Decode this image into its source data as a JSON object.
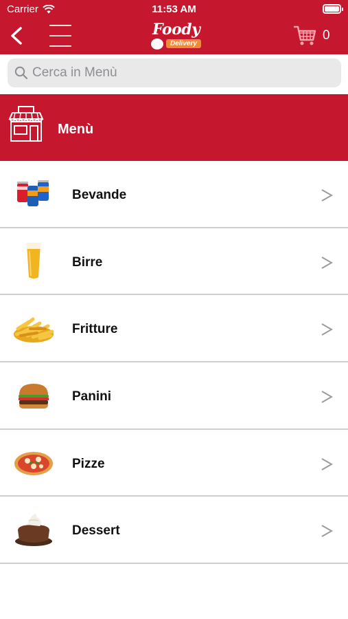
{
  "status_bar": {
    "carrier": "Carrier",
    "time": "11:53 AM",
    "battery_level": 1.0
  },
  "header": {
    "logo_word": "Foody",
    "logo_tag": "Delivery",
    "cart_count": "0"
  },
  "search": {
    "placeholder": "Cerca in Menù",
    "value": ""
  },
  "section": {
    "title": "Menù"
  },
  "categories": [
    {
      "label": "Bevande",
      "icon": "soda-cans-icon"
    },
    {
      "label": "Birre",
      "icon": "beer-glass-icon"
    },
    {
      "label": "Fritture",
      "icon": "french-fries-icon"
    },
    {
      "label": "Panini",
      "icon": "burger-icon"
    },
    {
      "label": "Pizze",
      "icon": "pizza-icon"
    },
    {
      "label": "Dessert",
      "icon": "lava-cake-icon"
    }
  ],
  "colors": {
    "brand_red": "#c5172e",
    "accent_orange": "#f08a3b",
    "search_bg": "#e9e9ea",
    "divider": "#cfcfd1"
  }
}
